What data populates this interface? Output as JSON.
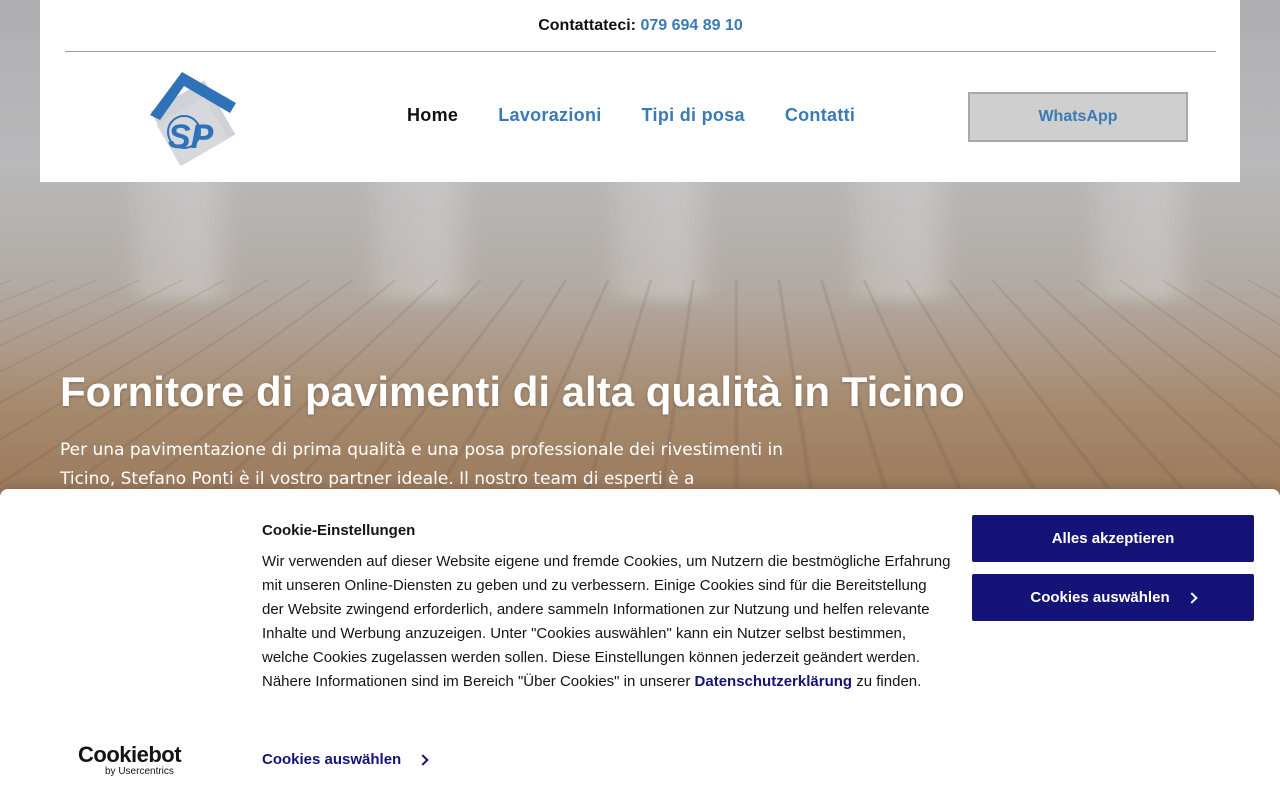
{
  "topbar": {
    "label": "Contattateci:",
    "phone": "079 694 89 10"
  },
  "logo": {
    "letters": "SP"
  },
  "nav": {
    "items": [
      {
        "label": "Home",
        "active": true
      },
      {
        "label": "Lavorazioni",
        "active": false
      },
      {
        "label": "Tipi di posa",
        "active": false
      },
      {
        "label": "Contatti",
        "active": false
      }
    ],
    "whatsapp_label": "WhatsApp"
  },
  "hero": {
    "title": "Fornitore di pavimenti di alta qualità in Ticino",
    "text": "Per una pavimentazione di prima qualità e una posa professionale dei rivestimenti in Ticino, Stefano Ponti è il vostro partner ideale. Il nostro team di esperti è a"
  },
  "cookie": {
    "title": "Cookie-Einstellungen",
    "body_before_link": "Wir verwenden auf dieser Website eigene und fremde Cookies, um Nutzern die bestmögliche Erfahrung mit unseren Online-Diensten zu geben und zu verbessern. Einige Cookies sind für die Bereitstellung der Website zwingend erforderlich, andere sammeln Informationen zur Nutzung und helfen relevante Inhalte und Werbung anzuzeigen. Unter \"Cookies auswählen\" kann ein Nutzer selbst bestimmen, welche Cookies zugelassen werden sollen. Diese Einstellungen können jederzeit geändert werden. Nähere Informationen sind im Bereich \"Über Cookies\" in unserer ",
    "link_label": "Datenschutzerklärung",
    "body_after_link": " zu finden.",
    "accept_label": "Alles akzeptieren",
    "select_label": "Cookies auswählen",
    "select_link_label": "Cookies auswählen",
    "brand": "Cookiebot",
    "brand_sub": "by Usercentrics"
  },
  "colors": {
    "link_blue": "#3a7ab8",
    "cookie_navy": "#141478"
  }
}
